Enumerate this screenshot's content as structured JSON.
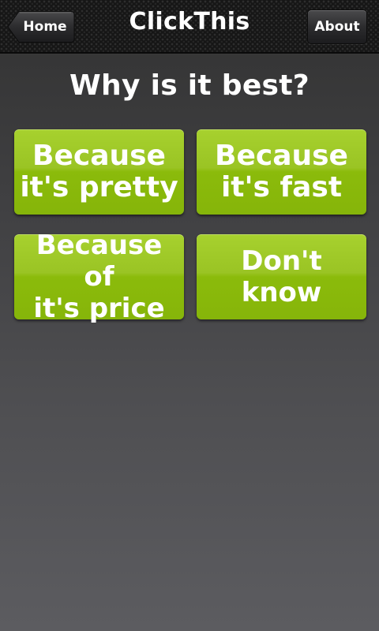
{
  "header": {
    "title": "ClickThis",
    "home_label": "Home",
    "about_label": "About"
  },
  "question": "Why is it best?",
  "answers": [
    {
      "label": "Because\nit's pretty"
    },
    {
      "label": "Because\nit's fast"
    },
    {
      "label": "Because of\nit's price"
    },
    {
      "label": "Don't know"
    }
  ],
  "colors": {
    "accent_green": "#8fbe10",
    "background": "#3f3f41",
    "top_bar": "#161616"
  }
}
